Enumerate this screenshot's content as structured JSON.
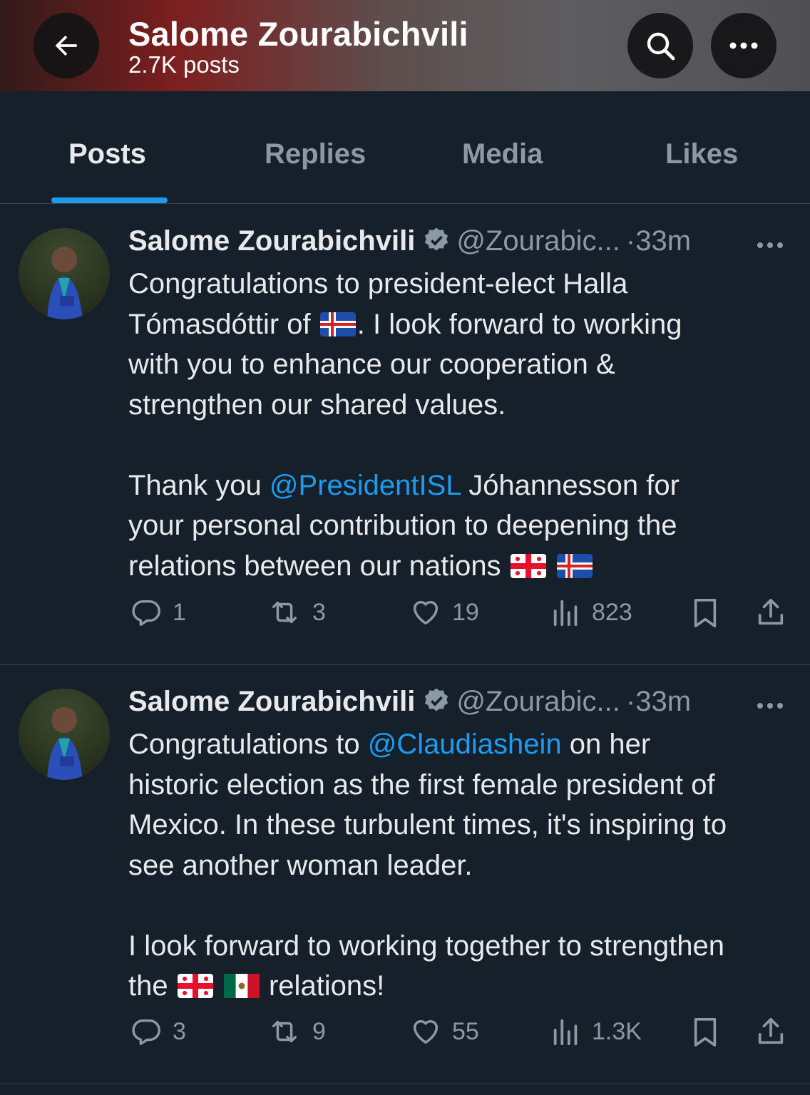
{
  "header": {
    "title": "Salome Zourabichvili",
    "post_count": "2.7K posts"
  },
  "tabs": [
    {
      "label": "Posts",
      "active": true
    },
    {
      "label": "Replies",
      "active": false
    },
    {
      "label": "Media",
      "active": false
    },
    {
      "label": "Likes",
      "active": false
    }
  ],
  "colors": {
    "background": "#15202b",
    "accent": "#1d9bf0",
    "muted": "#8b98a5",
    "text": "#e7e9ea"
  },
  "tweets": [
    {
      "name": "Salome Zourabichvili",
      "handle": "@Zourabic...",
      "sep": "·",
      "time": "33m",
      "body": {
        "l1": "Congratulations to president-elect Halla",
        "l2a": "Tómasdóttir of",
        "l2b": ".  I look forward to working",
        "l3": "with you to enhance our cooperation &",
        "l4": "strengthen our shared values.",
        "p2a": "Thank you",
        "p2mention": "@PresidentISL",
        "p2b": "Jóhannesson for",
        "p2l2": "your personal contribution to deepening the",
        "p2l3": "relations between our nations"
      },
      "stats": {
        "replies": "1",
        "reposts": "3",
        "likes": "19",
        "views": "823"
      }
    },
    {
      "name": "Salome Zourabichvili",
      "handle": "@Zourabic...",
      "sep": "·",
      "time": "33m",
      "body": {
        "l1a": "Congratulations to",
        "l1mention": "@Claudiashein",
        "l1b": "on her",
        "l2": "historic election as the first female president of",
        "l3": "Mexico. In these turbulent times, it's inspiring to",
        "l4": "see another woman leader.",
        "p2l1": "I look forward to working together to strengthen",
        "p2a": "the",
        "p2b": "relations!"
      },
      "stats": {
        "replies": "3",
        "reposts": "9",
        "likes": "55",
        "views": "1.3K"
      }
    }
  ]
}
